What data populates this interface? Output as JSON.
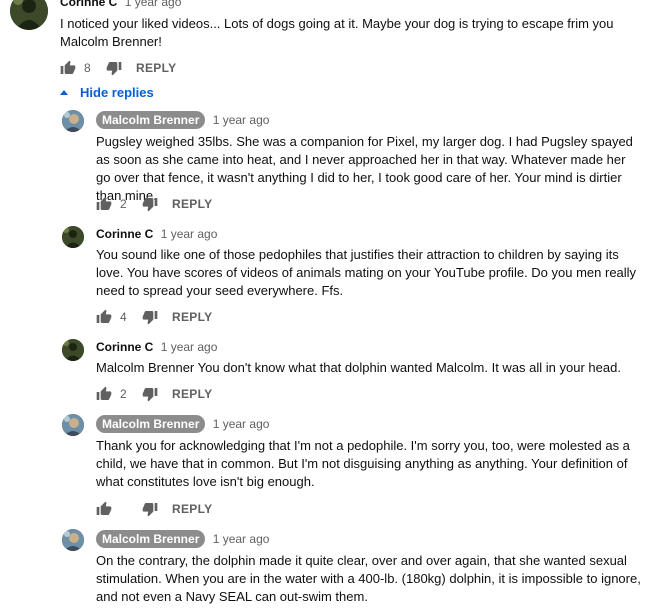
{
  "top_comment": {
    "author": "Corinne C",
    "time": "1 year ago",
    "text": "I noticed your liked videos... Lots of dogs going at it. Maybe your dog is trying to escape frim you Malcolm Brenner!",
    "likes": "8",
    "reply_label": "REPLY"
  },
  "hide_replies_label": "Hide replies",
  "replies": [
    {
      "author": "Malcolm Brenner",
      "time": "1 year ago",
      "text": "Pugsley weighed 35lbs. She was a companion for Pixel, my larger dog. I had Pugsley spayed as soon as she came into heat, and I never approached her in that way. Whatever made her go over that fence, it wasn't anything I did to her, I took good care of her. Your mind is dirtier than mine.",
      "likes": "2",
      "reply_label": "REPLY"
    },
    {
      "author": "Corinne C",
      "time": "1 year ago",
      "text": "You sound like one of those pedophiles that justifies their attraction to children by saying its love. You have scores of videos of animals mating on your YouTube profile. Do you men really need to spread your seed everywhere. Ffs.",
      "likes": "4",
      "reply_label": "REPLY"
    },
    {
      "author": "Corinne C",
      "time": "1 year ago",
      "text": "Malcolm Brenner You don't know what that dolphin wanted Malcolm. It was all in your head.",
      "likes": "2",
      "reply_label": "REPLY"
    },
    {
      "author": "Malcolm Brenner",
      "time": "1 year ago",
      "text": "Thank you for acknowledging that I'm not a pedophile. I'm sorry you, too, were molested as a child, we have that in common. But I'm not disguising anything as anything. Your definition of what constitutes love isn't big enough.",
      "likes": "",
      "reply_label": "REPLY"
    },
    {
      "author": "Malcolm Brenner",
      "time": "1 year ago",
      "text": "On the contrary, the dolphin made it quite clear, over and over again, that she wanted sexual stimulation. When you are in the water with a 400-lb. (180kg) dolphin, it is impossible to ignore, and not even a Navy SEAL can out-swim them."
    }
  ],
  "colors": {
    "link_blue": "#065fd4",
    "badge_gray": "#8c8c8c",
    "meta_gray": "#606060"
  }
}
